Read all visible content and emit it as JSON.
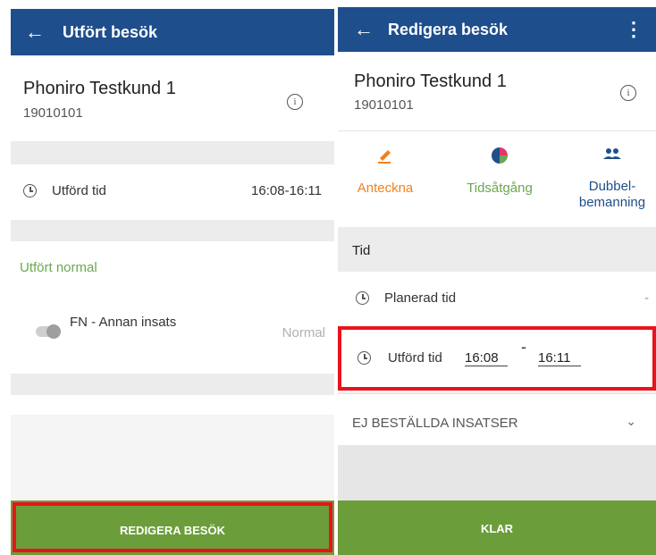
{
  "left": {
    "title": "Utfört besök",
    "back_icon": "arrow-left-icon",
    "customer_name": "Phoniro Testkund 1",
    "customer_id": "19010101",
    "info_icon": "info-icon",
    "performed_time_label": "Utförd tid",
    "performed_time_value": "16:08-16:11",
    "status_heading": "Utfört normal",
    "service_label": "FN - Annan insats",
    "service_status": "Normal",
    "button_label": "REDIGERA BESÖK"
  },
  "right": {
    "title": "Redigera besök",
    "back_icon": "arrow-left-icon",
    "menu_icon": "more-vertical-icon",
    "customer_name": "Phoniro Testkund 1",
    "customer_id": "19010101",
    "info_icon": "info-icon",
    "actions": [
      {
        "label": "Anteckna",
        "icon": "pencil-icon",
        "color": "#f0821e"
      },
      {
        "label": "Tidsåtgång",
        "icon": "pie-chart-icon",
        "color": "#6aa84f"
      },
      {
        "label": "Dubbel-",
        "label2": "bemanning",
        "icon": "people-icon",
        "color": "#1f4e8c"
      }
    ],
    "time_section": "Tid",
    "planned_time_label": "Planerad tid",
    "planned_time_value": "-",
    "performed_time_label": "Utförd tid",
    "performed_start": "16:08",
    "performed_separator": "-",
    "performed_end": "16:11",
    "unordered_label": "EJ BESTÄLLDA INSATSER",
    "button_label": "KLAR"
  },
  "colors": {
    "appbar": "#1f4e8c",
    "button_green": "#6b9e3a",
    "highlight_red": "#e8131c",
    "status_green": "#6aa84f"
  }
}
